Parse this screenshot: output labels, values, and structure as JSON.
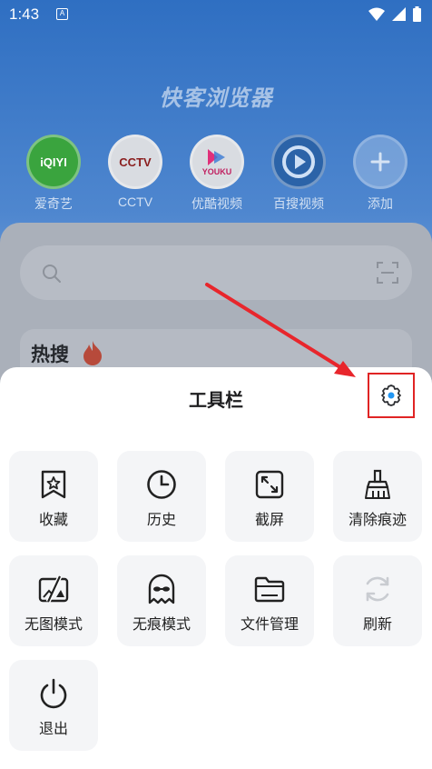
{
  "status_bar": {
    "time": "1:43",
    "sim_glyph": "A"
  },
  "home": {
    "app_title": "快客浏览器",
    "shortcuts": [
      {
        "label": "爱奇艺",
        "logo_text": "iQIYI",
        "icon": "iqiyi-logo"
      },
      {
        "label": "CCTV",
        "logo_text": "CCTV",
        "icon": "cctv-logo"
      },
      {
        "label": "优酷视频",
        "logo_text": "YOUKU",
        "icon": "youku-logo"
      },
      {
        "label": "百搜视频",
        "icon": "play-logo"
      },
      {
        "label": "添加",
        "icon": "plus-icon"
      }
    ],
    "hot_title": "热搜"
  },
  "toolbar": {
    "title": "工具栏",
    "settings_icon": "gear-icon",
    "items": [
      {
        "label": "收藏",
        "icon": "bookmark-star-icon"
      },
      {
        "label": "历史",
        "icon": "clock-icon"
      },
      {
        "label": "截屏",
        "icon": "screenshot-expand-icon"
      },
      {
        "label": "清除痕迹",
        "icon": "broom-icon"
      },
      {
        "label": "无图模式",
        "icon": "no-image-icon"
      },
      {
        "label": "无痕模式",
        "icon": "ghost-icon"
      },
      {
        "label": "文件管理",
        "icon": "folder-icon"
      },
      {
        "label": "刷新",
        "icon": "refresh-icon"
      },
      {
        "label": "退出",
        "icon": "power-icon"
      }
    ]
  },
  "colors": {
    "highlight_box": "#e02424",
    "arrow": "#e8262c",
    "settings_icon_dot": "#2196f3",
    "disabled_icon": "#c9ccd1"
  }
}
